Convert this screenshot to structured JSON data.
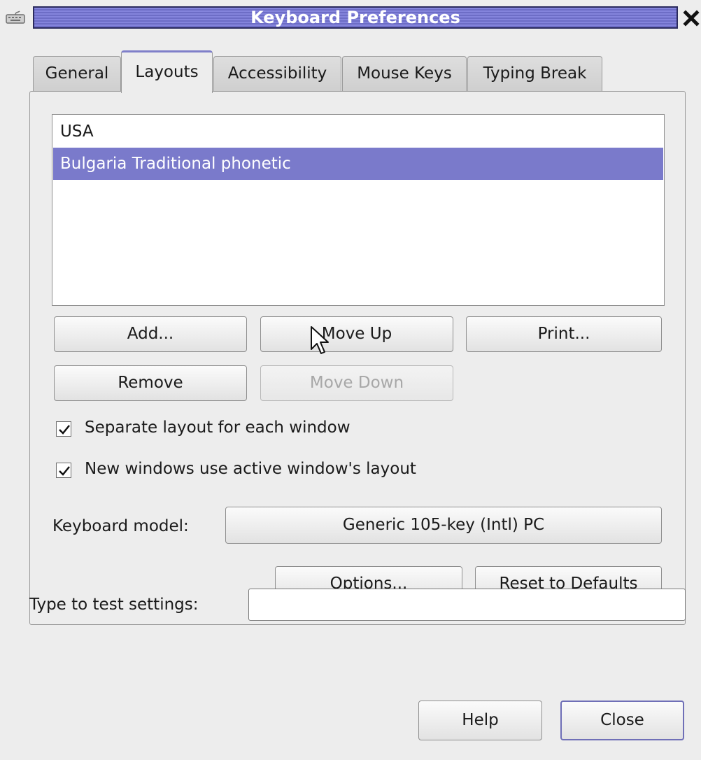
{
  "window": {
    "title": "Keyboard Preferences"
  },
  "tabs": [
    {
      "label": "General"
    },
    {
      "label": "Layouts"
    },
    {
      "label": "Accessibility"
    },
    {
      "label": "Mouse Keys"
    },
    {
      "label": "Typing Break"
    }
  ],
  "layouts": {
    "items": [
      {
        "label": "USA"
      },
      {
        "label": "Bulgaria Traditional phonetic"
      }
    ],
    "selected_index": 1,
    "buttons": {
      "add": "Add...",
      "move_up": "Move Up",
      "print": "Print...",
      "remove": "Remove",
      "move_down": "Move Down"
    },
    "separate_layout": {
      "label": "Separate layout for each window",
      "checked": true
    },
    "new_windows": {
      "label": "New windows use active window's layout",
      "checked": true
    },
    "keyboard_model": {
      "label": "Keyboard model:",
      "value": "Generic 105-key (Intl) PC"
    },
    "options_button": "Options...",
    "reset_button": "Reset to Defaults"
  },
  "test": {
    "label": "Type to test settings:",
    "value": ""
  },
  "footer": {
    "help": "Help",
    "close": "Close"
  },
  "icons": {
    "window_menu": "keyboard-icon",
    "close": "close-icon",
    "cursor": "mouse-pointer-icon",
    "check": "checkmark-icon"
  },
  "colors": {
    "selection": "#7a7acb",
    "titlebar": "#7777d2"
  }
}
